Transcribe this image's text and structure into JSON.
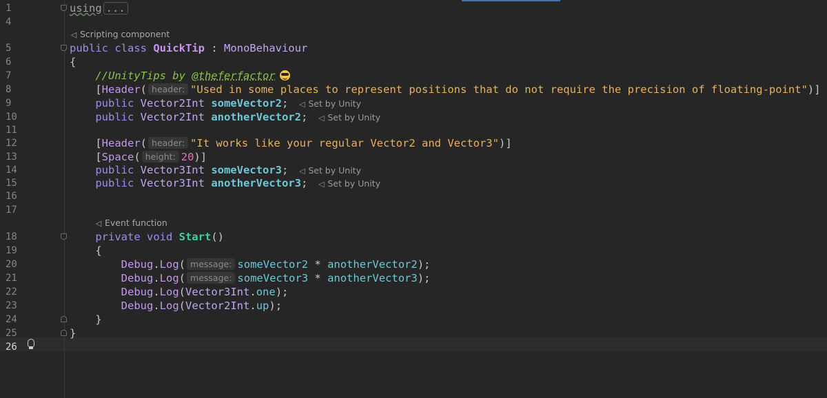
{
  "editor": {
    "lines": [
      {
        "n": "1",
        "tokens": [
          {
            "c": "folded-using",
            "t": "using"
          },
          {
            "c": "folded-box",
            "t": "..."
          }
        ]
      },
      {
        "n": "4",
        "tokens": []
      },
      {
        "n": "5",
        "tokens": [
          {
            "c": "kw",
            "t": "public class "
          },
          {
            "c": "cls",
            "t": "QuickTip"
          },
          {
            "c": "muted",
            "t": " : "
          },
          {
            "c": "type",
            "t": "MonoBehaviour"
          }
        ]
      },
      {
        "n": "6",
        "tokens": [
          {
            "c": "muted",
            "t": "{"
          }
        ]
      },
      {
        "n": "7",
        "tokens": [
          {
            "c": "comment",
            "t": "    //UnityTips by "
          },
          {
            "c": "comment-link",
            "t": "@theferfactor"
          }
        ]
      },
      {
        "n": "8",
        "tokens": [
          {
            "c": "muted",
            "t": "    ["
          },
          {
            "c": "attr",
            "t": "Header"
          },
          {
            "c": "muted",
            "t": "("
          },
          {
            "c": "hint",
            "t": "header:"
          },
          {
            "c": "str",
            "t": "\"Used in some places to represent positions that do not require the precision of floating-point\""
          },
          {
            "c": "muted",
            "t": ")]"
          }
        ]
      },
      {
        "n": "9",
        "tokens": [
          {
            "c": "kw",
            "t": "    public "
          },
          {
            "c": "type",
            "t": "Vector2Int "
          },
          {
            "c": "ident",
            "t": "someVector2"
          },
          {
            "c": "muted",
            "t": ";"
          },
          {
            "c": "lens",
            "t": "Set by Unity"
          }
        ]
      },
      {
        "n": "10",
        "tokens": [
          {
            "c": "kw",
            "t": "    public "
          },
          {
            "c": "type",
            "t": "Vector2Int "
          },
          {
            "c": "ident",
            "t": "anotherVector2"
          },
          {
            "c": "muted",
            "t": ";"
          },
          {
            "c": "lens",
            "t": "Set by Unity"
          }
        ]
      },
      {
        "n": "11",
        "tokens": []
      },
      {
        "n": "12",
        "tokens": [
          {
            "c": "muted",
            "t": "    ["
          },
          {
            "c": "attr",
            "t": "Header"
          },
          {
            "c": "muted",
            "t": "("
          },
          {
            "c": "hint",
            "t": "header:"
          },
          {
            "c": "str",
            "t": "\"It works like your regular Vector2 and Vector3\""
          },
          {
            "c": "muted",
            "t": ")]"
          }
        ]
      },
      {
        "n": "13",
        "tokens": [
          {
            "c": "muted",
            "t": "    ["
          },
          {
            "c": "attr",
            "t": "Space"
          },
          {
            "c": "muted",
            "t": "("
          },
          {
            "c": "hint",
            "t": "height:"
          },
          {
            "c": "num",
            "t": "20"
          },
          {
            "c": "muted",
            "t": ")]"
          }
        ]
      },
      {
        "n": "14",
        "tokens": [
          {
            "c": "kw",
            "t": "    public "
          },
          {
            "c": "type",
            "t": "Vector3Int "
          },
          {
            "c": "ident",
            "t": "someVector3"
          },
          {
            "c": "muted",
            "t": ";"
          },
          {
            "c": "lens",
            "t": "Set by Unity"
          }
        ]
      },
      {
        "n": "15",
        "tokens": [
          {
            "c": "kw",
            "t": "    public "
          },
          {
            "c": "type",
            "t": "Vector3Int "
          },
          {
            "c": "ident",
            "t": "anotherVector3"
          },
          {
            "c": "muted",
            "t": ";"
          },
          {
            "c": "lens",
            "t": "Set by Unity"
          }
        ]
      },
      {
        "n": "16",
        "tokens": []
      },
      {
        "n": "17",
        "tokens": []
      },
      {
        "n": "18",
        "tokens": [
          {
            "c": "kw",
            "t": "    private void "
          },
          {
            "c": "method",
            "t": "Start"
          },
          {
            "c": "muted",
            "t": "()"
          }
        ]
      },
      {
        "n": "19",
        "tokens": [
          {
            "c": "muted",
            "t": "    {"
          }
        ]
      },
      {
        "n": "20",
        "tokens": [
          {
            "c": "call",
            "t": "        Debug"
          },
          {
            "c": "muted",
            "t": "."
          },
          {
            "c": "call",
            "t": "Log"
          },
          {
            "c": "muted",
            "t": "("
          },
          {
            "c": "hint",
            "t": "message:"
          },
          {
            "c": "ident-n",
            "t": "someVector2"
          },
          {
            "c": "muted",
            "t": " * "
          },
          {
            "c": "ident-n",
            "t": "anotherVector2"
          },
          {
            "c": "muted",
            "t": ");"
          }
        ]
      },
      {
        "n": "21",
        "tokens": [
          {
            "c": "call",
            "t": "        Debug"
          },
          {
            "c": "muted",
            "t": "."
          },
          {
            "c": "call",
            "t": "Log"
          },
          {
            "c": "muted",
            "t": "("
          },
          {
            "c": "hint",
            "t": "message:"
          },
          {
            "c": "ident-n",
            "t": "someVector3"
          },
          {
            "c": "muted",
            "t": " * "
          },
          {
            "c": "ident-n",
            "t": "anotherVector3"
          },
          {
            "c": "muted",
            "t": ");"
          }
        ]
      },
      {
        "n": "22",
        "tokens": [
          {
            "c": "call",
            "t": "        Debug"
          },
          {
            "c": "muted",
            "t": "."
          },
          {
            "c": "call",
            "t": "Log"
          },
          {
            "c": "muted",
            "t": "("
          },
          {
            "c": "type",
            "t": "Vector3Int"
          },
          {
            "c": "muted",
            "t": "."
          },
          {
            "c": "ident-n",
            "t": "one"
          },
          {
            "c": "muted",
            "t": ");"
          }
        ]
      },
      {
        "n": "23",
        "tokens": [
          {
            "c": "call",
            "t": "        Debug"
          },
          {
            "c": "muted",
            "t": "."
          },
          {
            "c": "call",
            "t": "Log"
          },
          {
            "c": "muted",
            "t": "("
          },
          {
            "c": "type",
            "t": "Vector2Int"
          },
          {
            "c": "muted",
            "t": "."
          },
          {
            "c": "ident-n",
            "t": "up"
          },
          {
            "c": "muted",
            "t": ");"
          }
        ]
      },
      {
        "n": "24",
        "tokens": [
          {
            "c": "muted",
            "t": "    }"
          }
        ]
      },
      {
        "n": "25",
        "tokens": [
          {
            "c": "muted",
            "t": "}"
          }
        ]
      },
      {
        "n": "26",
        "tokens": []
      }
    ],
    "code_lens": {
      "class": "Scripting component",
      "method": "Event function"
    }
  }
}
